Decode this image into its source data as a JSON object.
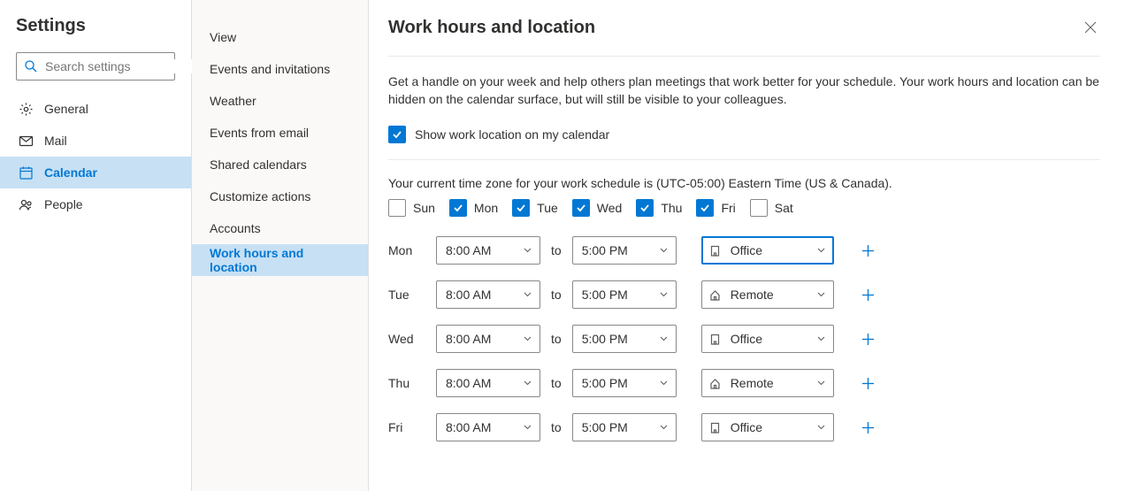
{
  "left": {
    "title": "Settings",
    "search_placeholder": "Search settings",
    "nav": [
      {
        "icon": "gear",
        "label": "General"
      },
      {
        "icon": "mail",
        "label": "Mail"
      },
      {
        "icon": "calendar",
        "label": "Calendar",
        "active": true
      },
      {
        "icon": "people",
        "label": "People"
      }
    ]
  },
  "mid": {
    "items": [
      {
        "label": "View"
      },
      {
        "label": "Events and invitations"
      },
      {
        "label": "Weather"
      },
      {
        "label": "Events from email"
      },
      {
        "label": "Shared calendars"
      },
      {
        "label": "Customize actions"
      },
      {
        "label": "Accounts"
      },
      {
        "label": "Work hours and location",
        "active": true
      }
    ]
  },
  "right": {
    "title": "Work hours and location",
    "description": "Get a handle on your week and help others plan meetings that work better for your schedule. Your work hours and location can be hidden on the calendar surface, but will still be visible to your colleagues.",
    "show_location_label": "Show work location on my calendar",
    "show_location_checked": true,
    "tz_note": "Your current time zone for your work schedule is (UTC-05:00) Eastern Time (US & Canada).",
    "days": [
      {
        "label": "Sun",
        "checked": false
      },
      {
        "label": "Mon",
        "checked": true
      },
      {
        "label": "Tue",
        "checked": true
      },
      {
        "label": "Wed",
        "checked": true
      },
      {
        "label": "Thu",
        "checked": true
      },
      {
        "label": "Fri",
        "checked": true
      },
      {
        "label": "Sat",
        "checked": false
      }
    ],
    "to_label": "to",
    "schedule": [
      {
        "day": "Mon",
        "start": "8:00 AM",
        "end": "5:00 PM",
        "location": "Office",
        "loc_icon": "office",
        "selected": true
      },
      {
        "day": "Tue",
        "start": "8:00 AM",
        "end": "5:00 PM",
        "location": "Remote",
        "loc_icon": "home"
      },
      {
        "day": "Wed",
        "start": "8:00 AM",
        "end": "5:00 PM",
        "location": "Office",
        "loc_icon": "office"
      },
      {
        "day": "Thu",
        "start": "8:00 AM",
        "end": "5:00 PM",
        "location": "Remote",
        "loc_icon": "home"
      },
      {
        "day": "Fri",
        "start": "8:00 AM",
        "end": "5:00 PM",
        "location": "Office",
        "loc_icon": "office"
      }
    ]
  }
}
